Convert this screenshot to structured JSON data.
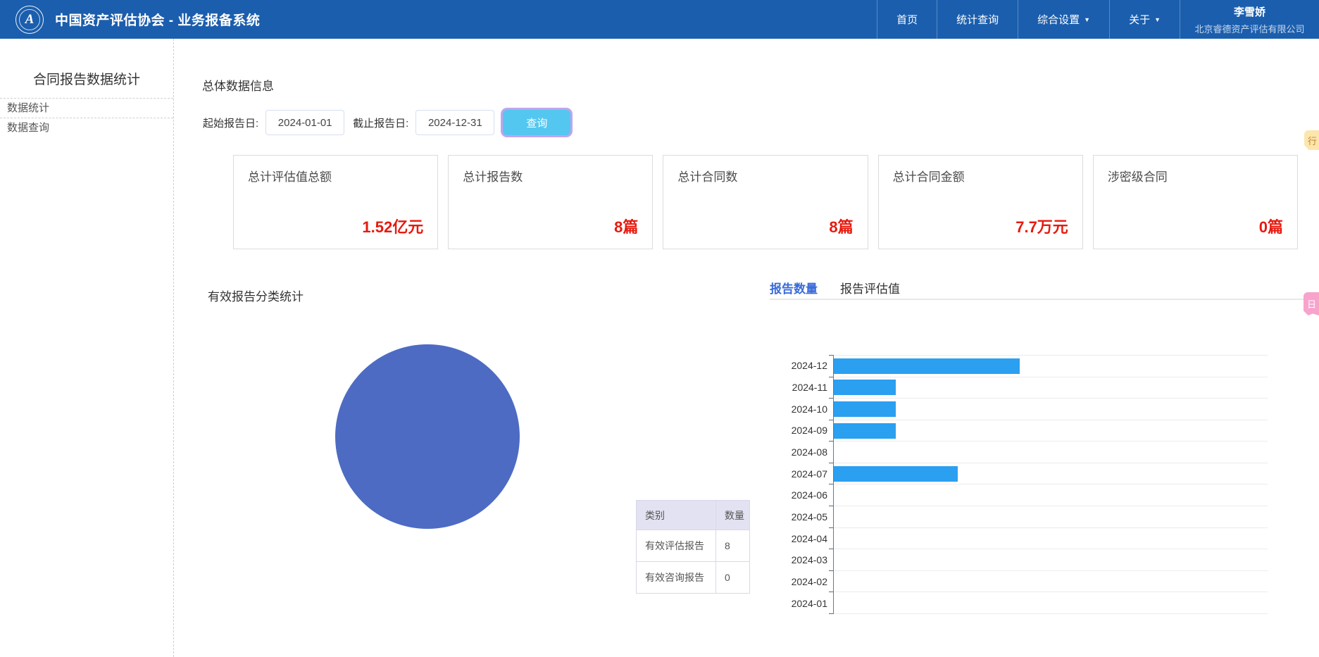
{
  "nav": {
    "brand": "中国资产评估协会 - 业务报备系统",
    "logo_glyph": "A",
    "items": [
      {
        "id": "home",
        "label": "首页",
        "has_caret": false
      },
      {
        "id": "statistics-query",
        "label": "统计查询",
        "has_caret": false
      },
      {
        "id": "general-settings",
        "label": "综合设置",
        "has_caret": true
      },
      {
        "id": "about",
        "label": "关于",
        "has_caret": true
      }
    ],
    "user": {
      "name": "李雪娇",
      "company": "北京睿德资产评估有限公司"
    }
  },
  "sidebar": {
    "title": "合同报告数据统计",
    "items": [
      {
        "id": "data-statistics",
        "label": "数据统计"
      },
      {
        "id": "data-query",
        "label": "数据查询"
      }
    ]
  },
  "main": {
    "section_title": "总体数据信息",
    "filter": {
      "start_label": "起始报告日:",
      "start_value": "2024-01-01",
      "end_label": "截止报告日:",
      "end_value": "2024-12-31",
      "query_label": "查询"
    },
    "stat_cards": [
      {
        "title": "总计评估值总额",
        "value": "1.52亿元"
      },
      {
        "title": "总计报告数",
        "value": "8篇"
      },
      {
        "title": "总计合同数",
        "value": "8篇"
      },
      {
        "title": "总计合同金额",
        "value": "7.7万元"
      },
      {
        "title": "涉密级合同",
        "value": "0篇"
      }
    ],
    "pie_section_title": "有效报告分类统计",
    "category_table": {
      "headers": [
        "类别",
        "数量"
      ],
      "rows": [
        [
          "有效评估报告",
          "8"
        ],
        [
          "有效咨询报告",
          "0"
        ]
      ]
    },
    "tabs": [
      {
        "id": "report-count",
        "label": "报告数量",
        "active": true
      },
      {
        "id": "report-value",
        "label": "报告评估值",
        "active": false
      }
    ]
  },
  "chart_data": [
    {
      "type": "pie",
      "title": "有效报告分类统计",
      "labels": [
        "有效评估报告",
        "有效咨询报告"
      ],
      "values": [
        8,
        0
      ],
      "colors": [
        "#4d6bc3"
      ],
      "legend_position": "table-right"
    },
    {
      "type": "bar",
      "orientation": "horizontal",
      "title": "报告数量",
      "categories": [
        "2024-12",
        "2024-11",
        "2024-10",
        "2024-09",
        "2024-08",
        "2024-07",
        "2024-06",
        "2024-05",
        "2024-04",
        "2024-03",
        "2024-02",
        "2024-01"
      ],
      "values": [
        3,
        1,
        1,
        1,
        0,
        2,
        0,
        0,
        0,
        0,
        0,
        0
      ],
      "xlabel": "",
      "ylabel": "",
      "xlim": [
        0,
        7
      ],
      "grid": true,
      "bar_color": "#2b9ff0"
    }
  ],
  "edge_tags": [
    {
      "id": "yellow",
      "glyph": "行",
      "bg": "#fbe7ae",
      "fg": "#c9812b"
    },
    {
      "id": "pink",
      "glyph": "日",
      "bg": "#f7a3cc",
      "fg": "#ffffff"
    }
  ],
  "colors": {
    "navbar_bg": "#1b5ead",
    "stat_value_red": "#e71a0f",
    "query_button_bg": "#54c7f0",
    "query_button_ring": "#c0a5ec",
    "tab_active": "#3a6bd8",
    "pie_fill": "#4d6bc3",
    "bar_fill": "#2b9ff0",
    "table_header_bg": "#e2e2f2"
  }
}
